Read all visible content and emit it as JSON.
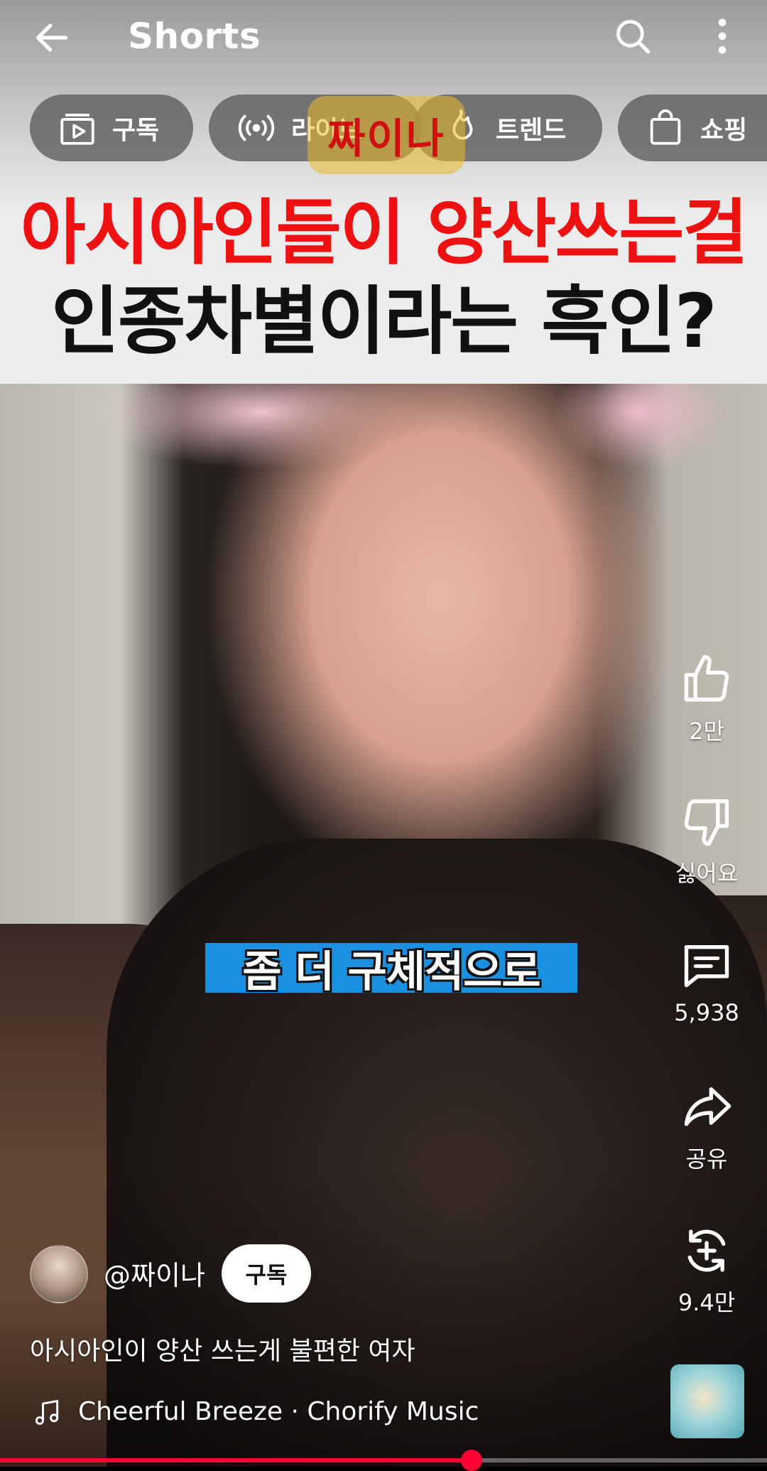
{
  "header": {
    "title": "Shorts"
  },
  "chips": [
    {
      "label": "구독",
      "icon": "subscriptions-icon"
    },
    {
      "label": "라이브",
      "icon": "live-icon"
    },
    {
      "label": "트렌드",
      "icon": "trending-icon"
    },
    {
      "label": "쇼핑",
      "icon": "shopping-bag-icon"
    }
  ],
  "overlay": {
    "logo_text": "짜이나",
    "headline_line1": "아시아인들이 양산쓰는걸",
    "headline_line2": "인종차별이라는 흑인?",
    "caption": "좀 더 구체적으로"
  },
  "actions": {
    "like_count": "2만",
    "dislike_label": "싫어요",
    "comment_count": "5,938",
    "share_label": "공유",
    "remix_count": "9.4만"
  },
  "channel": {
    "handle": "@짜이나",
    "subscribe_label": "구독"
  },
  "video": {
    "title": "아시아인이 양산 쓰는게 불편한 여자",
    "music": "Cheerful Breeze · Chorify Music"
  },
  "progress": {
    "fraction": 0.615
  },
  "colors": {
    "accent": "#ff0033",
    "headline_red": "#ee1111",
    "caption_blue": "#1b8fe0"
  }
}
